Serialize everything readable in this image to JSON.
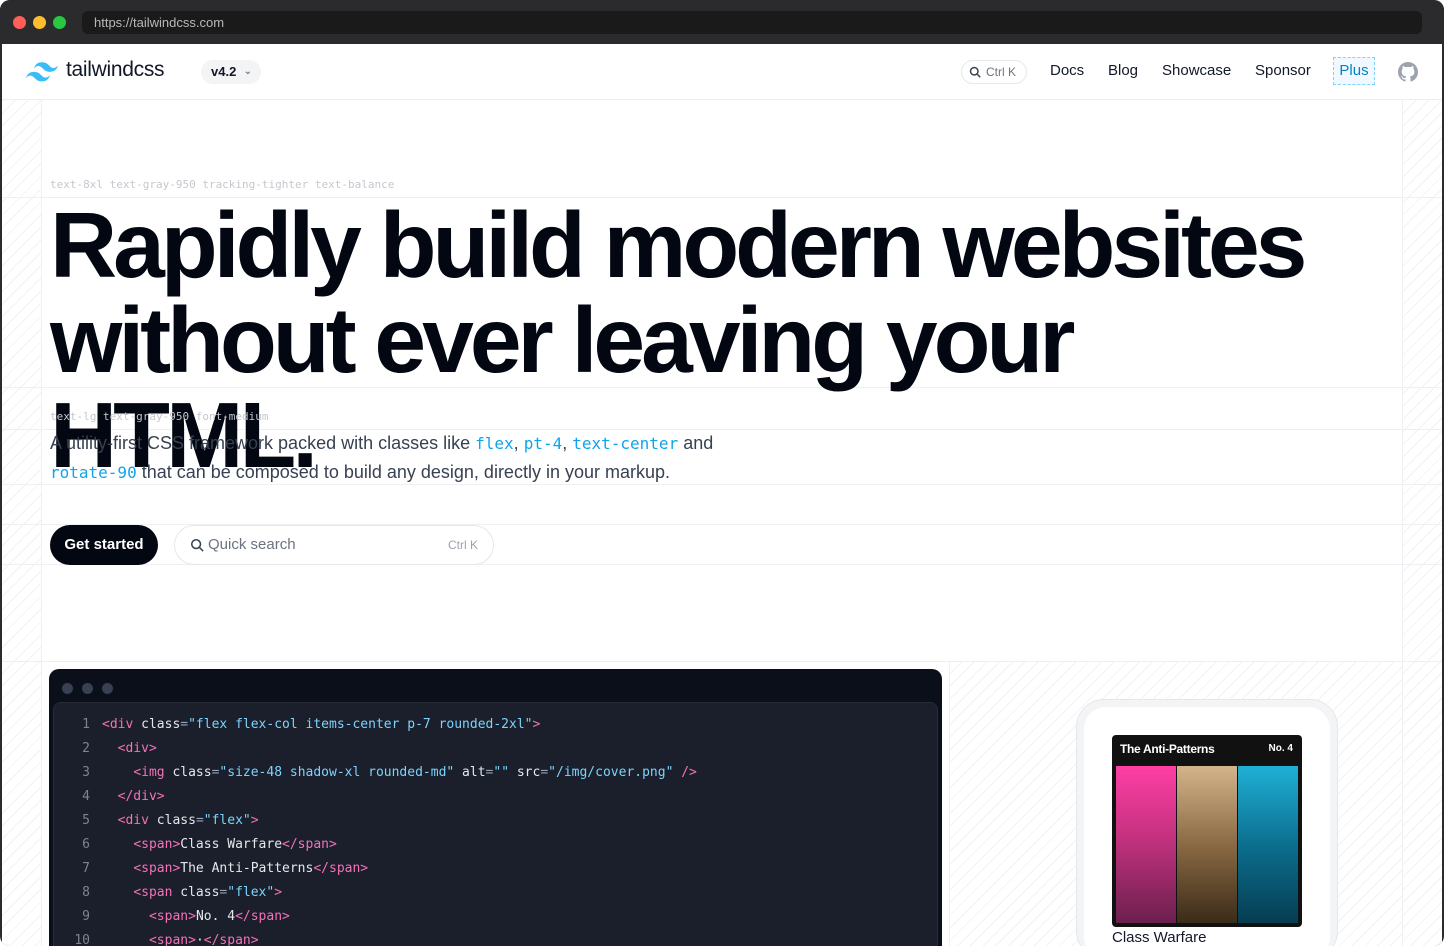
{
  "browser": {
    "url": "https://tailwindcss.com",
    "colors": {
      "close": "#ff5f57",
      "minimize": "#febc2e",
      "zoom": "#28c840"
    }
  },
  "nav": {
    "brand": "tailwindcss",
    "version": "v4.2",
    "search_shortcut": "Ctrl K",
    "links": [
      "Docs",
      "Blog",
      "Showcase",
      "Sponsor"
    ],
    "plus": "Plus",
    "github_icon": "github-icon"
  },
  "hero": {
    "headline_class": "text-8xl text-gray-950 tracking-tighter text-balance",
    "headline_line1": "Rapidly build modern websites",
    "headline_line2": "without ever leaving your HTML.",
    "lede_class": "text-lg text-gray-950 font-medium",
    "lede": {
      "part1": "A utility-first CSS framework packed with classes like ",
      "code1": "flex",
      "sep1": ", ",
      "code2": "pt-4",
      "sep2": ", ",
      "code3": "text-center",
      "part2": " and ",
      "code4": "rotate-90",
      "part3": " that can be composed to build any design, directly in your markup."
    },
    "cta": "Get started",
    "quick_search": {
      "placeholder": "Quick search",
      "shortcut": "Ctrl K"
    }
  },
  "editor": {
    "lines": [
      {
        "n": "1",
        "indent": "",
        "parts": [
          [
            "t",
            "<div "
          ],
          [
            "a",
            "class"
          ],
          [
            "p",
            "="
          ],
          [
            "s",
            "\"flex flex-col items-center p-7 rounded-2xl\""
          ],
          [
            "t",
            ">"
          ]
        ]
      },
      {
        "n": "2",
        "indent": "  ",
        "parts": [
          [
            "t",
            "<div>"
          ]
        ]
      },
      {
        "n": "3",
        "indent": "    ",
        "parts": [
          [
            "t",
            "<img "
          ],
          [
            "a",
            "class"
          ],
          [
            "p",
            "="
          ],
          [
            "s",
            "\"size-48 shadow-xl rounded-md\""
          ],
          [
            "a",
            " alt"
          ],
          [
            "p",
            "="
          ],
          [
            "s",
            "\"\""
          ],
          [
            "a",
            " src"
          ],
          [
            "p",
            "="
          ],
          [
            "s",
            "\"/img/cover.png\""
          ],
          [
            "t",
            " />"
          ]
        ]
      },
      {
        "n": "4",
        "indent": "  ",
        "parts": [
          [
            "t",
            "</div>"
          ]
        ]
      },
      {
        "n": "5",
        "indent": "  ",
        "parts": [
          [
            "t",
            "<div "
          ],
          [
            "a",
            "class"
          ],
          [
            "p",
            "="
          ],
          [
            "s",
            "\"flex\""
          ],
          [
            "t",
            ">"
          ]
        ]
      },
      {
        "n": "6",
        "indent": "    ",
        "parts": [
          [
            "t",
            "<span>"
          ],
          [
            "a",
            "Class Warfare"
          ],
          [
            "t",
            "</span>"
          ]
        ]
      },
      {
        "n": "7",
        "indent": "    ",
        "parts": [
          [
            "t",
            "<span>"
          ],
          [
            "a",
            "The Anti-Patterns"
          ],
          [
            "t",
            "</span>"
          ]
        ]
      },
      {
        "n": "8",
        "indent": "    ",
        "parts": [
          [
            "t",
            "<span "
          ],
          [
            "a",
            "class"
          ],
          [
            "p",
            "="
          ],
          [
            "s",
            "\"flex\""
          ],
          [
            "t",
            ">"
          ]
        ]
      },
      {
        "n": "9",
        "indent": "      ",
        "parts": [
          [
            "t",
            "<span>"
          ],
          [
            "a",
            "No. 4"
          ],
          [
            "t",
            "</span>"
          ]
        ]
      },
      {
        "n": "10",
        "indent": "      ",
        "parts": [
          [
            "t",
            "<span>"
          ],
          [
            "a",
            "·"
          ],
          [
            "t",
            "</span>"
          ]
        ]
      }
    ]
  },
  "preview": {
    "album_title": "The Anti-Patterns",
    "album_no": "No. 4",
    "song": "Class Warfare"
  }
}
